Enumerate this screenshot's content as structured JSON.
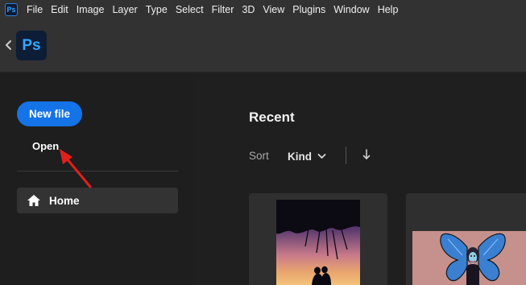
{
  "menubar": {
    "app_icon_text": "Ps",
    "items": [
      "File",
      "Edit",
      "Image",
      "Layer",
      "Type",
      "Select",
      "Filter",
      "3D",
      "View",
      "Plugins",
      "Window",
      "Help"
    ]
  },
  "appbar": {
    "logo_text": "Ps",
    "icons": {
      "back": "chevron-left-icon"
    }
  },
  "sidebar": {
    "new_file_label": "New file",
    "open_label": "Open",
    "home_label": "Home",
    "icons": {
      "home": "home-icon"
    }
  },
  "main": {
    "recent_title": "Recent",
    "sort_label": "Sort",
    "sort_value": "Kind",
    "icons": {
      "sort_dropdown": "chevron-down-icon",
      "sort_direction": "arrow-down-icon"
    }
  },
  "colors": {
    "accent": "#1473e6",
    "annotation_arrow": "#e0201b",
    "menubar_bg": "#323232",
    "page_bg": "#1f1f1f"
  }
}
